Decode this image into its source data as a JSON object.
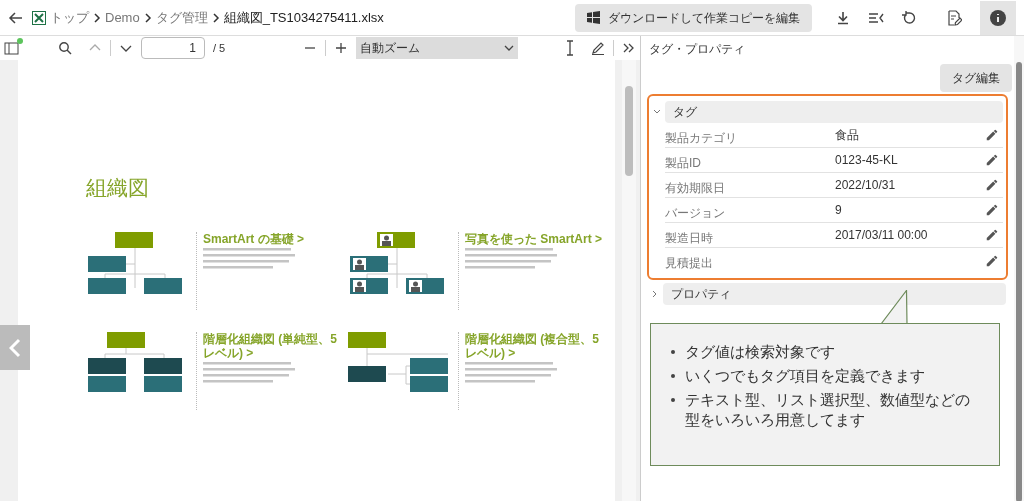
{
  "breadcrumb": [
    "トップ",
    "Demo",
    "タグ管理",
    "組織図_TS1034275411.xlsx"
  ],
  "download_button": "ダウンロードして作業コピーを編集",
  "viewer_toolbar": {
    "page": "1",
    "page_count": "/ 5",
    "zoom": "自動ズーム"
  },
  "document": {
    "title": "組織図",
    "sections": [
      {
        "kind": "basic",
        "heading": "SmartArt の基礎 >"
      },
      {
        "kind": "photo",
        "heading": "写真を使った SmartArt >"
      },
      {
        "kind": "hierarchy",
        "heading": "階層化組織図 (単純型、5 レベル) >"
      },
      {
        "kind": "hybrid",
        "heading": "階層化組織図 (複合型、5 レベル) >"
      }
    ]
  },
  "panel": {
    "title": "タグ・プロパティ",
    "edit_button": "タグ編集",
    "groups": [
      {
        "label": "タグ",
        "expanded": true,
        "rows": [
          {
            "label": "製品カテゴリ",
            "value": "食品"
          },
          {
            "label": "製品ID",
            "value": "0123-45-KL"
          },
          {
            "label": "有効期限日",
            "value": "2022/10/31"
          },
          {
            "label": "バージョン",
            "value": "9"
          },
          {
            "label": "製造日時",
            "value": "2017/03/11 00:00"
          },
          {
            "label": "見積提出",
            "value": ""
          }
        ]
      },
      {
        "label": "プロパティ",
        "expanded": false
      }
    ]
  },
  "callout": [
    "タグ値は検索対象です",
    "いくつでもタグ項目を定義できます",
    "テキスト型、リスト選択型、数値型などの型をいろいろ用意してます"
  ]
}
